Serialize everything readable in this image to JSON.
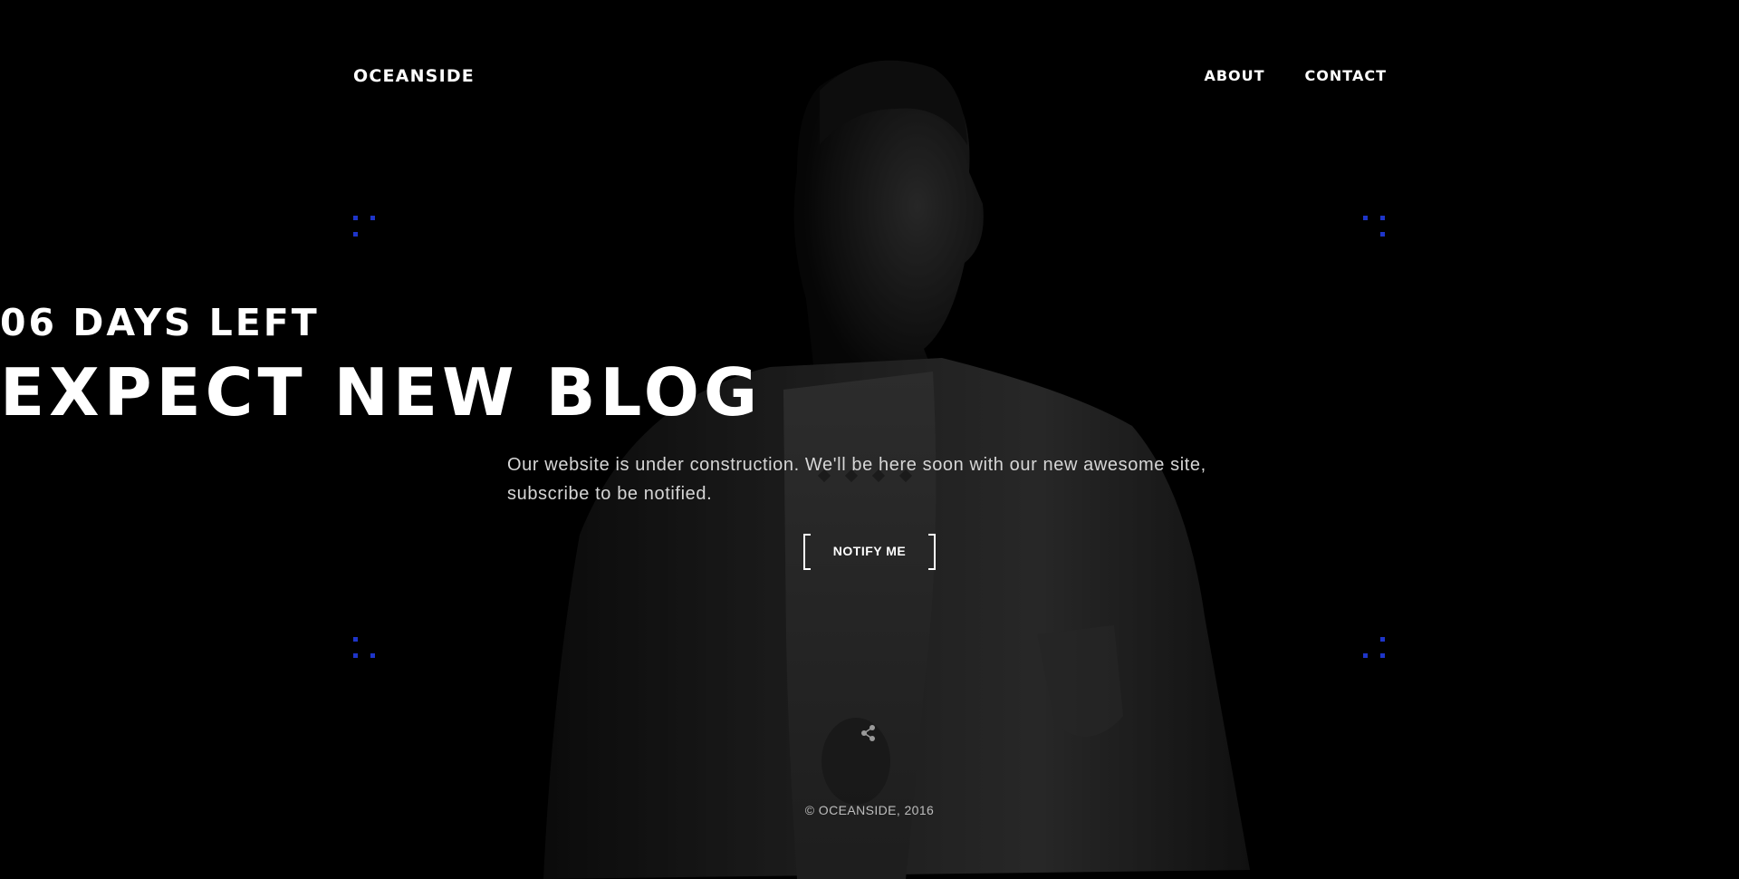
{
  "site": {
    "logo": "OCEANSIDE"
  },
  "nav": {
    "items": [
      {
        "label": "ABOUT"
      },
      {
        "label": "CONTACT"
      }
    ]
  },
  "hero": {
    "countdown": "06 DAYS LEFT",
    "headline": "EXPECT NEW BLOG",
    "subtitle_line1": "Our website is under construction. We'll be here soon with our new awesome site,",
    "subtitle_line2": "subscribe to be notified.",
    "cta_label": "NOTIFY ME"
  },
  "footer": {
    "share_icon": "share-icon",
    "copyright": "© OCEANSIDE, 2016"
  },
  "colors": {
    "background": "#000000",
    "accent_dots": "#1e35c9",
    "text": "#ffffff"
  }
}
